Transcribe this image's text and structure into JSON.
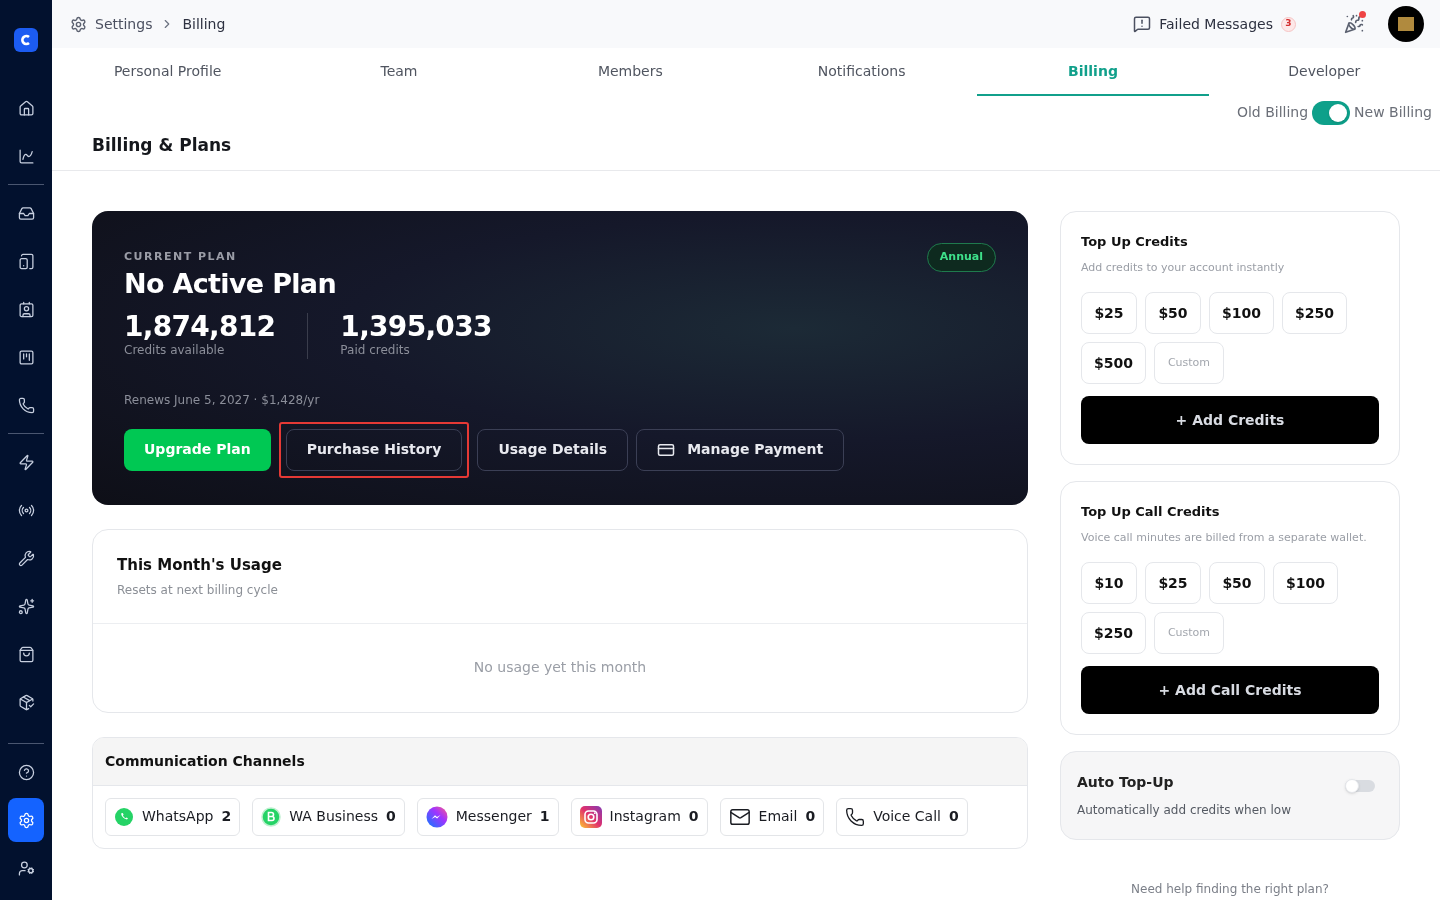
{
  "sidebar": {
    "groups": [
      [
        {
          "selected": false
        },
        {
          "selected": false
        }
      ],
      [
        {
          "selected": false
        },
        {
          "selected": false
        },
        {
          "selected": false
        },
        {
          "selected": false
        },
        {
          "selected": false
        }
      ],
      [
        {
          "selected": false
        },
        {
          "selected": false
        },
        {
          "selected": false
        },
        {
          "selected": false
        },
        {
          "selected": false
        },
        {
          "selected": false
        }
      ],
      [
        {
          "selected": false
        },
        {
          "selected": true
        },
        {
          "selected": false
        }
      ]
    ]
  },
  "breadcrumb": [
    "Settings",
    "Billing"
  ],
  "header": {
    "failed_messages": {
      "label": "Failed Messages",
      "count": "3"
    },
    "notification_dot": true
  },
  "tabs": [
    {
      "label": "Personal Profile",
      "selected": false
    },
    {
      "label": "Team",
      "selected": false
    },
    {
      "label": "Members",
      "selected": false
    },
    {
      "label": "Notifications",
      "selected": false
    },
    {
      "label": "Billing",
      "selected": true
    },
    {
      "label": "Developer",
      "selected": false
    }
  ],
  "billing_switch": {
    "left": "Old Billing",
    "right": "New Billing",
    "on": true
  },
  "page_title": "Billing & Plans",
  "plan": {
    "eyebrow": "CURRENT PLAN",
    "name": "No Active Plan",
    "badge": "Annual",
    "stats": [
      {
        "value": "1,874,812",
        "label": "Credits available"
      },
      {
        "value": "1,395,033",
        "label": "Paid credits"
      }
    ],
    "renewal": "Renews June 5, 2027 · $1,428/yr",
    "actions": [
      {
        "label": "Upgrade Plan",
        "kind": "primary",
        "highlighted": false
      },
      {
        "label": "Purchase History",
        "kind": "outline",
        "highlighted": true
      },
      {
        "label": "Usage Details",
        "kind": "outline",
        "highlighted": false
      },
      {
        "label": "Manage Payment",
        "kind": "card",
        "highlighted": false
      }
    ]
  },
  "usage": {
    "title": "This Month's Usage",
    "subtitle": "Resets at next billing cycle",
    "empty": "No usage yet this month"
  },
  "channels": {
    "title": "Communication Channels",
    "items": [
      {
        "name": "WhatsApp",
        "count": "2",
        "kind": "whatsapp"
      },
      {
        "name": "WA Business",
        "count": "0",
        "kind": "wabusiness"
      },
      {
        "name": "Messenger",
        "count": "1",
        "kind": "messenger"
      },
      {
        "name": "Instagram",
        "count": "0",
        "kind": "instagram"
      },
      {
        "name": "Email",
        "count": "0",
        "kind": "email"
      },
      {
        "name": "Voice Call",
        "count": "0",
        "kind": "voice"
      }
    ]
  },
  "topups": [
    {
      "title": "Top Up Credits",
      "subtitle": "Add credits to your account instantly",
      "amounts": [
        "$25",
        "$50",
        "$100",
        "$250",
        "$500"
      ],
      "custom": "Custom",
      "action": "+ Add Credits"
    },
    {
      "title": "Top Up Call Credits",
      "subtitle": "Voice call minutes are billed from a separate wallet.",
      "amounts": [
        "$10",
        "$25",
        "$50",
        "$100",
        "$250"
      ],
      "custom": "Custom",
      "action": "+ Add Call Credits"
    }
  ],
  "auto_topup": {
    "title": "Auto Top-Up",
    "subtitle": "Automatically add credits when low",
    "on": false
  },
  "help_text": "Need help finding the right plan?"
}
